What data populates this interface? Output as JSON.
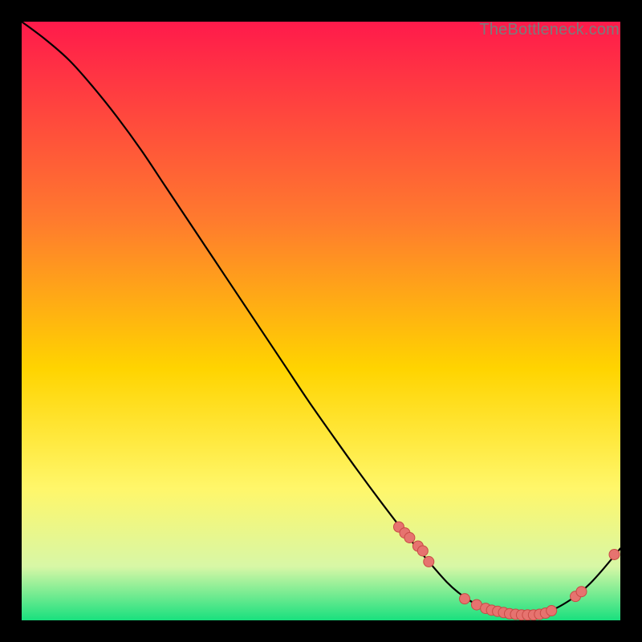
{
  "watermark": "TheBottleneck.com",
  "colors": {
    "top": "#ff1a4b",
    "mid1": "#ff7a2e",
    "mid2": "#ffd400",
    "mid3": "#fff76a",
    "mid4": "#d8f7a6",
    "bottom": "#19e07e",
    "curve": "#000000",
    "marker_fill": "#e6736f",
    "marker_stroke": "#c94a46"
  },
  "chart_data": {
    "type": "line",
    "title": "",
    "xlabel": "",
    "ylabel": "",
    "xlim": [
      0,
      100
    ],
    "ylim": [
      0,
      100
    ],
    "series": [
      {
        "name": "curve",
        "x": [
          0,
          4,
          8,
          12,
          16,
          20,
          24,
          28,
          32,
          36,
          40,
          44,
          48,
          52,
          56,
          60,
          64,
          68,
          71,
          73,
          75,
          77,
          79,
          81,
          83,
          85,
          87,
          89,
          91,
          93,
          95,
          97,
          100
        ],
        "y": [
          100,
          97,
          93.5,
          89,
          84,
          78.5,
          72.5,
          66.5,
          60.5,
          54.5,
          48.5,
          42.5,
          36.5,
          30.8,
          25.2,
          19.8,
          14.6,
          9.8,
          6.4,
          4.6,
          3.2,
          2.2,
          1.5,
          1.1,
          0.9,
          0.9,
          1.2,
          1.9,
          3.0,
          4.4,
          6.2,
          8.4,
          12.0
        ]
      }
    ],
    "markers": {
      "comment": "scatter of highlighted sample points along the curve",
      "x": [
        63.0,
        64.0,
        64.8,
        66.2,
        67.0,
        68.0,
        74.0,
        76.0,
        77.5,
        78.5,
        79.5,
        80.5,
        81.5,
        82.5,
        83.5,
        84.5,
        85.5,
        86.5,
        87.5,
        88.5,
        92.5,
        93.5,
        99.0
      ],
      "y": [
        15.6,
        14.6,
        13.8,
        12.4,
        11.6,
        9.8,
        3.6,
        2.6,
        2.0,
        1.7,
        1.5,
        1.3,
        1.1,
        1.0,
        0.9,
        0.9,
        0.9,
        1.0,
        1.2,
        1.6,
        4.0,
        4.8,
        11.0
      ]
    }
  }
}
